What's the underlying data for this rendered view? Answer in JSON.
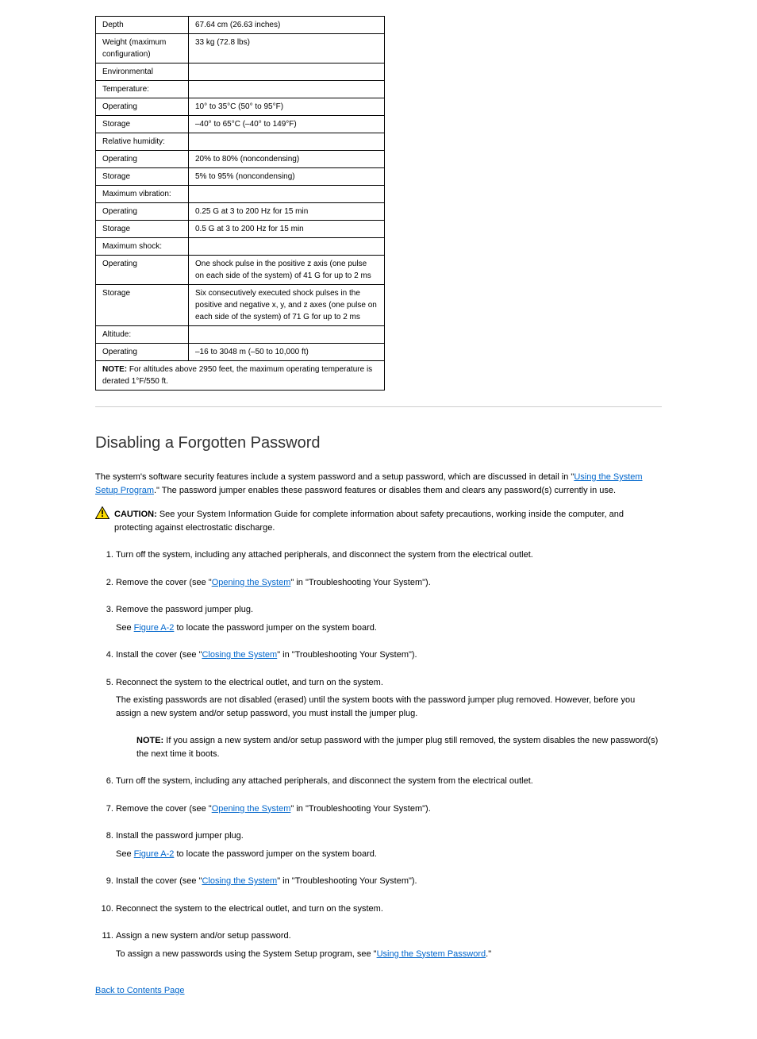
{
  "table": {
    "rows": [
      [
        "Depth",
        "67.64 cm (26.63 inches)"
      ],
      [
        "Weight (maximum configuration)",
        "33 kg (72.8 lbs)"
      ],
      [
        "Environmental",
        ""
      ],
      [
        "Temperature:",
        ""
      ],
      [
        "Operating",
        "10° to 35°C (50° to 95°F)"
      ],
      [
        "Storage",
        "–40° to 65°C (–40° to 149°F)"
      ],
      [
        "Relative humidity:",
        ""
      ],
      [
        "Operating",
        "20% to 80% (noncondensing)"
      ],
      [
        "Storage",
        "5% to 95% (noncondensing)"
      ],
      [
        "Maximum vibration:",
        ""
      ],
      [
        "Operating",
        "0.25 G at 3 to 200 Hz for 15 min"
      ],
      [
        "Storage",
        "0.5 G at 3 to 200 Hz for 15 min"
      ],
      [
        "Maximum shock:",
        ""
      ],
      [
        "Operating",
        "One shock pulse in the positive z axis (one pulse on each side of the system) of 41 G for up to 2 ms"
      ],
      [
        "Storage",
        "Six consecutively executed shock pulses in the positive and negative x, y, and z axes (one pulse on each side of the system) of 71 G for up to 2 ms"
      ],
      [
        "Altitude:",
        ""
      ],
      [
        "Operating",
        "–16 to 3048 m (–50 to 10,000 ft)"
      ]
    ],
    "note_row": "NOTE: For altitudes above 2950 feet, the maximum operating temperature is derated 1°F/550 ft."
  },
  "section_title": "Disabling a Forgotten Password",
  "intro1_a": "The system's software security features include a system password and a setup password, which are discussed in detail in \"",
  "intro1_link": "Using the System Setup Program",
  "intro1_b": ".\" The password jumper enables these password features or disables them and clears any password(s) currently in use.",
  "caution_label": "CAUTION:",
  "caution_text": " See your System Information Guide for complete information about safety precautions, working inside the computer, and protecting against electrostatic discharge.",
  "steps": [
    {
      "text": "Turn off the system, including any attached peripherals, and disconnect the system from the electrical outlet."
    },
    {
      "text_a": "Remove the cover (see \"",
      "link": "Opening the System",
      "text_b": "\" in \"Troubleshooting Your System\")."
    },
    {
      "text": "Remove the password jumper plug.",
      "sub_a": "See ",
      "sub_link": "Figure A-2",
      "sub_b": " to locate the password jumper on the system board."
    },
    {
      "text_a": "Install the cover (see \"",
      "link": "Closing the System",
      "text_b": "\" in \"Troubleshooting Your System\")."
    },
    {
      "text": "Reconnect the system to the electrical outlet, and turn on the system.",
      "para1": "The existing passwords are not disabled (erased) until the system boots with the password jumper plug removed. However, before you assign a new system and/or setup password, you must install the jumper plug.",
      "note_label": "NOTE:",
      "note_text": " If you assign a new system and/or setup password with the jumper plug still removed, the system disables the new password(s) the next time it boots."
    },
    {
      "text": "Turn off the system, including any attached peripherals, and disconnect the system from the electrical outlet."
    },
    {
      "text_a": "Remove the cover (see \"",
      "link": "Opening the System",
      "text_b": "\" in \"Troubleshooting Your System\")."
    },
    {
      "text": "Install the password jumper plug.",
      "sub_a": "See ",
      "sub_link": "Figure A-2",
      "sub_b": " to locate the password jumper on the system board."
    },
    {
      "text_a": "Install the cover (see \"",
      "link": "Closing the System",
      "text_b": "\" in \"Troubleshooting Your System\")."
    },
    {
      "text": "Reconnect the system to the electrical outlet, and turn on the system."
    },
    {
      "text": "Assign a new system and/or setup password.",
      "para_a": "To assign a new passwords using the System Setup program, see \"",
      "para_link": "Using the System Password",
      "para_b": ".\""
    }
  ],
  "back_link": "Back to Contents Page"
}
